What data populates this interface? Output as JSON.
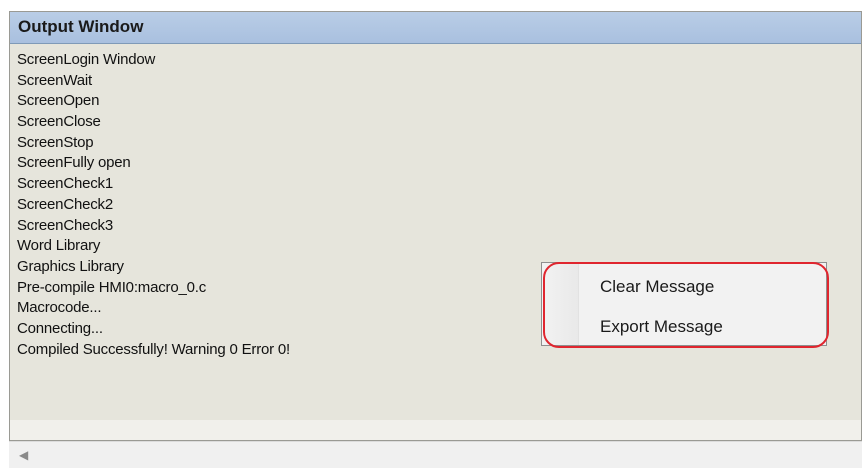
{
  "window": {
    "title": "Output Window"
  },
  "messages": [
    "ScreenLogin Window",
    "ScreenWait",
    "ScreenOpen",
    "ScreenClose",
    "ScreenStop",
    "ScreenFully open",
    "ScreenCheck1",
    "ScreenCheck2",
    "ScreenCheck3",
    "Word Library",
    "Graphics Library",
    "Pre-compile HMI0:macro_0.c",
    "Macrocode...",
    "Connecting...",
    "Compiled Successfully! Warning 0 Error 0!"
  ],
  "context_menu": {
    "items": [
      {
        "label": "Clear Message"
      },
      {
        "label": "Export Message"
      }
    ],
    "highlight_color": "#e0262f"
  },
  "scrollbar": {
    "left_arrow_icon": "chevron-left-icon"
  },
  "colors": {
    "title_bar": "#b0c6e2",
    "panel_background": "#e6e5dc"
  }
}
